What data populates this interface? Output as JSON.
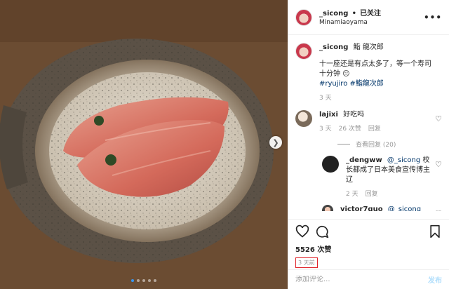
{
  "header": {
    "username": "_sicong",
    "separator": "•",
    "follow_state": "已关注",
    "location": "Minamiaoyama",
    "more_icon": "more-dots-icon"
  },
  "caption": {
    "username": "_sicong",
    "text": "十一座还是有点太多了，等一个寿司十分钟 😐",
    "tags": [
      "#ryujiro",
      "#鮨龍次郎"
    ],
    "header_suffix": "鮨 龍次郎",
    "time": "3 天"
  },
  "comments": [
    {
      "username": "lajixi",
      "text": "好吃吗",
      "time": "3 天",
      "likes": "26 次赞",
      "reply_label": "回复",
      "view_replies": "查看回复 (20)"
    },
    {
      "username": "_dengww",
      "mention": "@_sicong",
      "text": "校长都成了日本美食宣传博主辽",
      "time": "2 天",
      "reply_label": "回复"
    },
    {
      "username": "victor7guo",
      "mention": "@_sicong"
    }
  ],
  "actions": {
    "likes": "5526 次赞",
    "time_ago": "3 天前"
  },
  "composer": {
    "placeholder": "添加评论...",
    "post_label": "发布"
  },
  "photo": {
    "carousel_dots": 5,
    "active_dot": 0
  },
  "colors": {
    "link": "#003569",
    "accent": "#3897f0",
    "highlight_box": "#e0242a"
  }
}
